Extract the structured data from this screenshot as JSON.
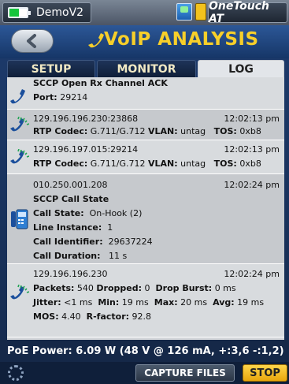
{
  "status_bar": {
    "profile_name": "DemoV2",
    "device_name": "OneTouch AT",
    "icons": [
      "battery-icon",
      "network-icon",
      "usb-icon"
    ]
  },
  "title_bar": {
    "back_icon": "back-arrow-icon",
    "title_icon": "phone-handset-icon",
    "title": "VoIP ANALYSIS"
  },
  "tabs": [
    {
      "label": "SETUP",
      "active": false
    },
    {
      "label": "MONITOR",
      "active": false
    },
    {
      "label": "LOG",
      "active": true
    }
  ],
  "log": {
    "entries": [
      {
        "icon": "phone-handset-icon",
        "lines": [
          {
            "label": "SCCP Open Rx Channel ACK"
          },
          {
            "label": "Port:",
            "value": "29214"
          }
        ]
      },
      {
        "icon": "rtp-stream-icon",
        "header": "129.196.196.230:23868",
        "time": "12:02:13 pm",
        "codec_label": "RTP Codec:",
        "codec": "G.711/G.712",
        "vlan_label": "VLAN:",
        "vlan": "untag",
        "tos_label": "TOS:",
        "tos": "0xb8"
      },
      {
        "icon": "rtp-stream-icon",
        "header": "129.196.197.015:29214",
        "time": "12:02:13 pm",
        "codec_label": "RTP Codec:",
        "codec": "G.711/G.712",
        "vlan_label": "VLAN:",
        "vlan": "untag",
        "tos_label": "TOS:",
        "tos": "0xb8"
      },
      {
        "icon": "ip-phone-icon",
        "header": "010.250.001.208",
        "time": "12:02:24 pm",
        "title": "SCCP Call State",
        "fields": [
          {
            "label": "Call State:",
            "value": "On-Hook (2)"
          },
          {
            "label": "Line Instance:",
            "value": "1"
          },
          {
            "label": "Call Identifier:",
            "value": "29637224"
          },
          {
            "label": "Call Duration:",
            "value": "11 s"
          }
        ]
      },
      {
        "icon": "rtp-stream-icon",
        "header": "129.196.196.230",
        "time": "12:02:24 pm",
        "packets_label": "Packets:",
        "packets": "540",
        "dropped_label": "Dropped:",
        "dropped": "0",
        "burst_label": "Drop Burst:",
        "burst": "0 ms",
        "jitter_label": "Jitter:",
        "jitter": "<1 ms",
        "min_label": "Min:",
        "min": "19 ms",
        "max_label": "Max:",
        "max": "20 ms",
        "avg_label": "Avg:",
        "avg": "19 ms",
        "mos_label": "MOS:",
        "mos": "4.40",
        "rfactor_label": "R-factor:",
        "rfactor": "92.8"
      }
    ]
  },
  "footer": {
    "poe_text": "PoE Power: 6.09 W (48 V @ 126 mA, +:3,6 -:1,2)",
    "capture_label": "CAPTURE FILES",
    "stop_label": "STOP"
  },
  "colors": {
    "title_yellow": "#f7cf2a",
    "stop_button": "#f2b51a",
    "header_blue": "#1d3c6e"
  }
}
